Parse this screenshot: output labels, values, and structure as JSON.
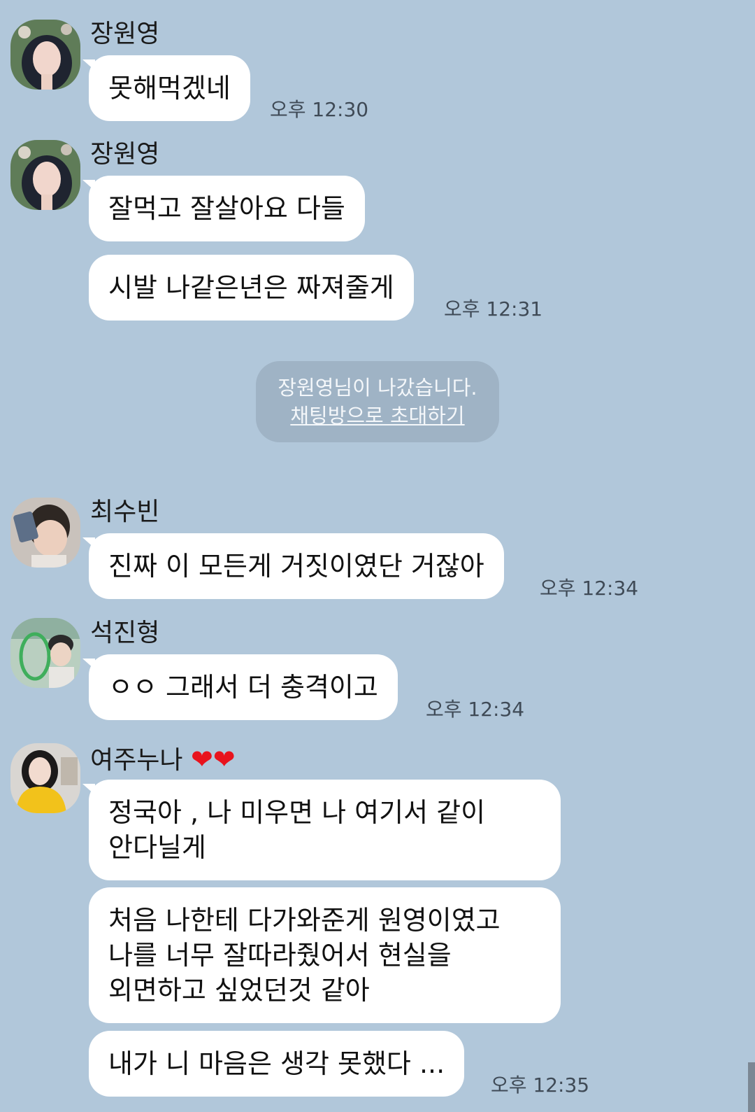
{
  "messages": [
    {
      "sender": "장원영",
      "bubbles": [
        "못해먹겠네"
      ],
      "time": "오후 12:30"
    },
    {
      "sender": "장원영",
      "bubbles": [
        "잘먹고 잘살아요 다들",
        "시발 나같은년은 짜져줄게"
      ],
      "time": "오후 12:31"
    },
    {
      "sender": "최수빈",
      "bubbles": [
        "진짜 이 모든게 거짓이였단 거잖아"
      ],
      "time": "오후 12:34"
    },
    {
      "sender": "석진형",
      "bubbles": [
        "ㅇㅇ 그래서 더 충격이고"
      ],
      "time": "오후 12:34"
    },
    {
      "sender": "여주누나",
      "sender_suffix": "❤❤",
      "bubbles": [
        "정국아 , 나 미우면 나 여기서 같이\n안다닐게",
        "처음 나한테 다가와준게 원영이였고\n나를 너무 잘따라줬어서 현실을\n외면하고 싶었던것 같아",
        "내가 니 마음은 생각 못했다 ..."
      ],
      "time": "오후 12:35"
    }
  ],
  "system_notice": {
    "text": "장원영님이 나갔습니다.",
    "invite_link": "채팅방으로 초대하기"
  },
  "colors": {
    "background": "#b1c7da",
    "bubble": "#ffffff",
    "notice_bg": "#9fb3c5"
  }
}
